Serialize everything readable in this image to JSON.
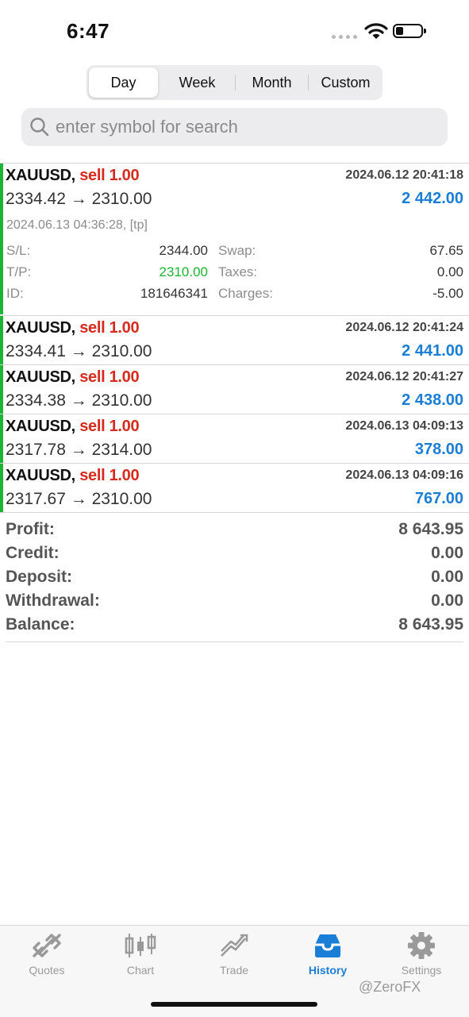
{
  "status": {
    "time": "6:47"
  },
  "segment": {
    "items": [
      "Day",
      "Week",
      "Month",
      "Custom"
    ],
    "active": "Day"
  },
  "search": {
    "placeholder": "enter symbol for search",
    "value": ""
  },
  "deals": [
    {
      "symbol": "XAUUSD,",
      "side": "sell 1.00",
      "open_time": "2024.06.12 20:41:18",
      "prices": "2334.42 → 2310.00",
      "profit": "2 442.00",
      "close_time": "2024.06.13 04:36:28, [tp]",
      "details": {
        "sl_label": "S/L:",
        "sl": "2344.00",
        "tp_label": "T/P:",
        "tp": "2310.00",
        "id_label": "ID:",
        "id": "181646341",
        "swap_label": "Swap:",
        "swap": "67.65",
        "taxes_label": "Taxes:",
        "taxes": "0.00",
        "charges_label": "Charges:",
        "charges": "-5.00"
      }
    },
    {
      "symbol": "XAUUSD,",
      "side": "sell 1.00",
      "open_time": "2024.06.12 20:41:24",
      "prices": "2334.41 → 2310.00",
      "profit": "2 441.00"
    },
    {
      "symbol": "XAUUSD,",
      "side": "sell 1.00",
      "open_time": "2024.06.12 20:41:27",
      "prices": "2334.38 → 2310.00",
      "profit": "2 438.00"
    },
    {
      "symbol": "XAUUSD,",
      "side": "sell 1.00",
      "open_time": "2024.06.13 04:09:13",
      "prices": "2317.78 → 2314.00",
      "profit": "378.00"
    },
    {
      "symbol": "XAUUSD,",
      "side": "sell 1.00",
      "open_time": "2024.06.13 04:09:16",
      "prices": "2317.67 → 2310.00",
      "profit": "767.00"
    }
  ],
  "summary": [
    {
      "label": "Profit:",
      "value": "8 643.95"
    },
    {
      "label": "Credit:",
      "value": "0.00"
    },
    {
      "label": "Deposit:",
      "value": "0.00"
    },
    {
      "label": "Withdrawal:",
      "value": "0.00"
    },
    {
      "label": "Balance:",
      "value": "8 643.95"
    }
  ],
  "tabs": [
    {
      "label": "Quotes",
      "icon": "quotes-icon"
    },
    {
      "label": "Chart",
      "icon": "chart-icon"
    },
    {
      "label": "Trade",
      "icon": "trade-icon"
    },
    {
      "label": "History",
      "icon": "history-icon",
      "active": true
    },
    {
      "label": "Settings",
      "icon": "settings-icon"
    }
  ],
  "watermark": "@ZeroFX",
  "colors": {
    "accent": "#1a7ed6",
    "sell": "#d62b1e",
    "tp_green": "#1bb434",
    "deal_bar": "#1bb434"
  }
}
